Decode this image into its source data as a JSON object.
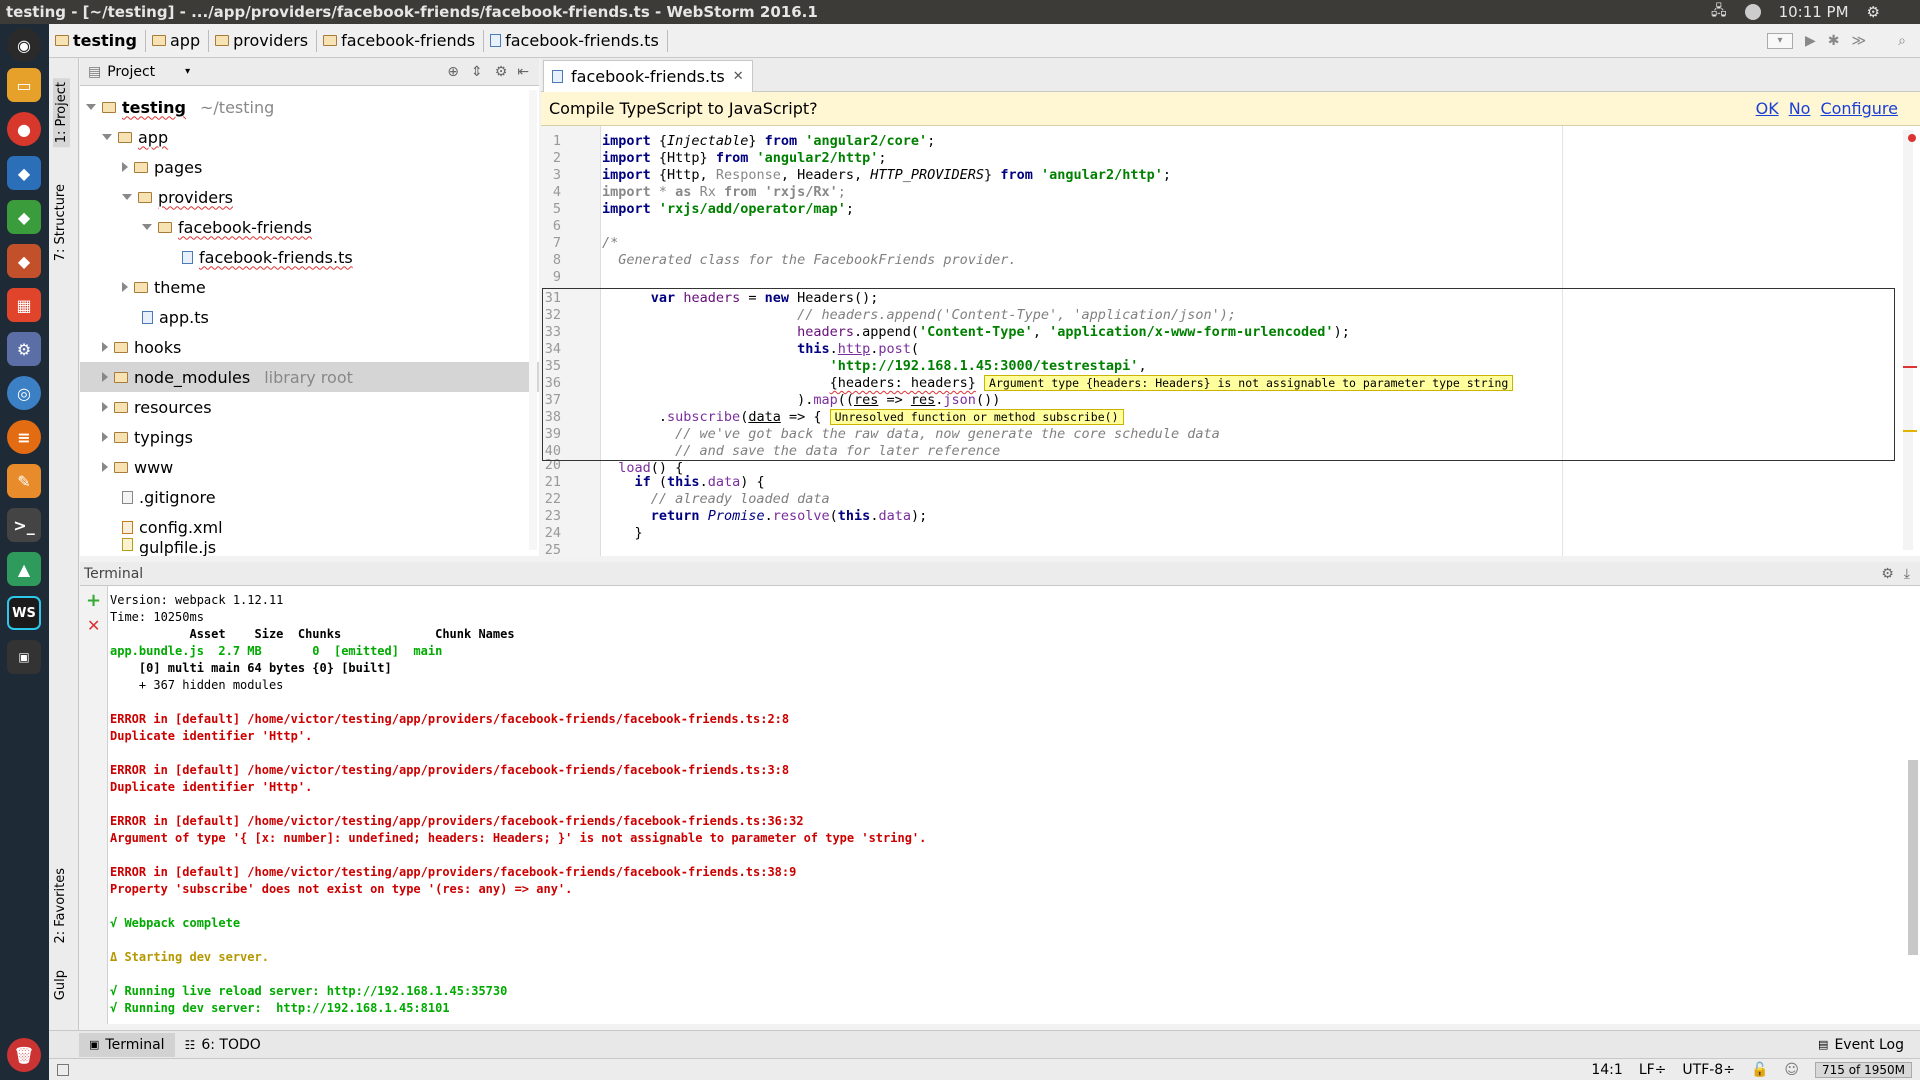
{
  "window": {
    "title": "testing - [~/testing] - .../app/providers/facebook-friends/facebook-friends.ts - WebStorm 2016.1"
  },
  "tray": {
    "time": "10:11 PM"
  },
  "breadcrumbs": [
    "testing",
    "app",
    "providers",
    "facebook-friends",
    "facebook-friends.ts"
  ],
  "left_strip": {
    "project": "1: Project",
    "structure": "7: Structure",
    "favorites": "2: Favorites",
    "gulp": "Gulp"
  },
  "project": {
    "header": "Project",
    "tree": [
      {
        "label": "testing",
        "hint": "~/testing",
        "kind": "folder",
        "bold": true
      },
      {
        "label": "app",
        "kind": "folder"
      },
      {
        "label": "pages",
        "kind": "folder"
      },
      {
        "label": "providers",
        "kind": "folder"
      },
      {
        "label": "facebook-friends",
        "kind": "folder"
      },
      {
        "label": "facebook-friends.ts",
        "kind": "file"
      },
      {
        "label": "theme",
        "kind": "folder"
      },
      {
        "label": "app.ts",
        "kind": "file"
      },
      {
        "label": "hooks",
        "kind": "folder"
      },
      {
        "label": "node_modules",
        "hint": "library root",
        "kind": "folder"
      },
      {
        "label": "resources",
        "kind": "folder"
      },
      {
        "label": "typings",
        "kind": "folder"
      },
      {
        "label": "www",
        "kind": "folder"
      },
      {
        "label": ".gitignore",
        "kind": "file"
      },
      {
        "label": "config.xml",
        "kind": "file"
      },
      {
        "label": "gulpfile.js",
        "kind": "file"
      }
    ]
  },
  "editor": {
    "tab": "facebook-friends.ts",
    "notification": {
      "question": "Compile TypeScript to JavaScript?",
      "ok": "OK",
      "no": "No",
      "configure": "Configure"
    },
    "line_numbers": [
      "1",
      "2",
      "3",
      "4",
      "5",
      "6",
      "7",
      "8",
      "9",
      "31",
      "32",
      "33",
      "34",
      "35",
      "36",
      "37",
      "38",
      "39",
      "40",
      "20",
      "21",
      "22",
      "23",
      "24",
      "25"
    ],
    "tooltips": {
      "line36": "Argument type {headers: Headers} is not assignable to parameter type string",
      "line38": "Unresolved function or method subscribe()"
    }
  },
  "terminal": {
    "header": "Terminal",
    "lines": [
      "Version: webpack 1.12.11",
      "Time: 10250ms",
      "           Asset    Size  Chunks             Chunk Names",
      "app.bundle.js  2.7 MB       0  [emitted]  main",
      "    [0] multi main 64 bytes {0} [built]",
      "    + 367 hidden modules",
      "",
      "ERROR in [default] /home/victor/testing/app/providers/facebook-friends/facebook-friends.ts:2:8",
      "Duplicate identifier 'Http'.",
      "",
      "ERROR in [default] /home/victor/testing/app/providers/facebook-friends/facebook-friends.ts:3:8",
      "Duplicate identifier 'Http'.",
      "",
      "ERROR in [default] /home/victor/testing/app/providers/facebook-friends/facebook-friends.ts:36:32",
      "Argument of type '{ [x: number]: undefined; headers: Headers; }' is not assignable to parameter of type 'string'.",
      "",
      "ERROR in [default] /home/victor/testing/app/providers/facebook-friends/facebook-friends.ts:38:9",
      "Property 'subscribe' does not exist on type '(res: any) => any'.",
      "",
      "√ Webpack complete",
      "",
      "Δ Starting dev server.",
      "",
      "√ Running live reload server: http://192.168.1.45:35730",
      "√ Running dev server:  http://192.168.1.45:8101"
    ]
  },
  "bottom_tabs": {
    "terminal": "Terminal",
    "todo": "6: TODO",
    "event_log": "Event Log"
  },
  "status": {
    "position": "14:1",
    "line_sep": "LF÷",
    "encoding": "UTF-8÷",
    "memory": "715 of 1950M"
  },
  "colors": {
    "keyword": "#000080",
    "string": "#008000",
    "error": "#cc0000",
    "success": "#00aa00",
    "warning": "#b59800"
  }
}
